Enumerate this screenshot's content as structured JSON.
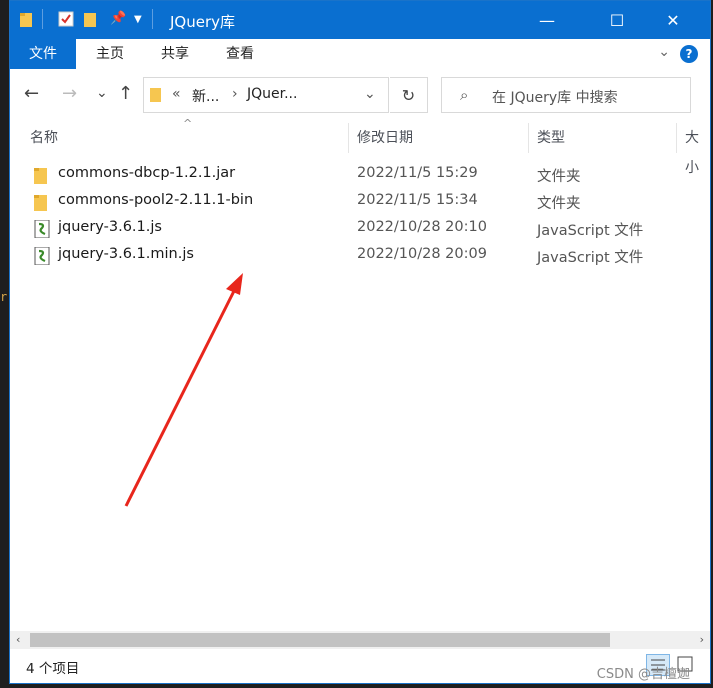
{
  "window": {
    "title": "JQuery库",
    "minimize": "—",
    "maximize": "☐",
    "close": "✕"
  },
  "ribbon": {
    "tabs": [
      "文件",
      "主页",
      "共享",
      "查看"
    ],
    "help": "?"
  },
  "nav": {
    "back": "←",
    "forward": "→",
    "recent": "⌄",
    "up": "↑",
    "breadcrumb_overflow": "«",
    "breadcrumb": [
      "新...",
      "JQuer..."
    ],
    "dropdown": "⌄",
    "refresh": "↻",
    "search_placeholder": "在 JQuery库 中搜索"
  },
  "columns": {
    "name": "名称",
    "date": "修改日期",
    "type": "类型",
    "size": "大小"
  },
  "files": [
    {
      "name": "commons-dbcp-1.2.1.jar",
      "date": "2022/11/5 15:29",
      "type": "文件夹",
      "icon": "folder-icon"
    },
    {
      "name": "commons-pool2-2.11.1-bin",
      "date": "2022/11/5 15:34",
      "type": "文件夹",
      "icon": "folder-icon"
    },
    {
      "name": "jquery-3.6.1.js",
      "date": "2022/10/28 20:10",
      "type": "JavaScript 文件",
      "icon": "script-file-icon"
    },
    {
      "name": "jquery-3.6.1.min.js",
      "date": "2022/10/28 20:09",
      "type": "JavaScript 文件",
      "icon": "script-file-icon"
    }
  ],
  "status": {
    "count": "4 个项目"
  },
  "watermark": "CSDN @吉檀迦",
  "colors": {
    "titlebar": "#0a6fd0",
    "annotation_arrow": "#e8261c"
  },
  "left_edge_text": "r"
}
